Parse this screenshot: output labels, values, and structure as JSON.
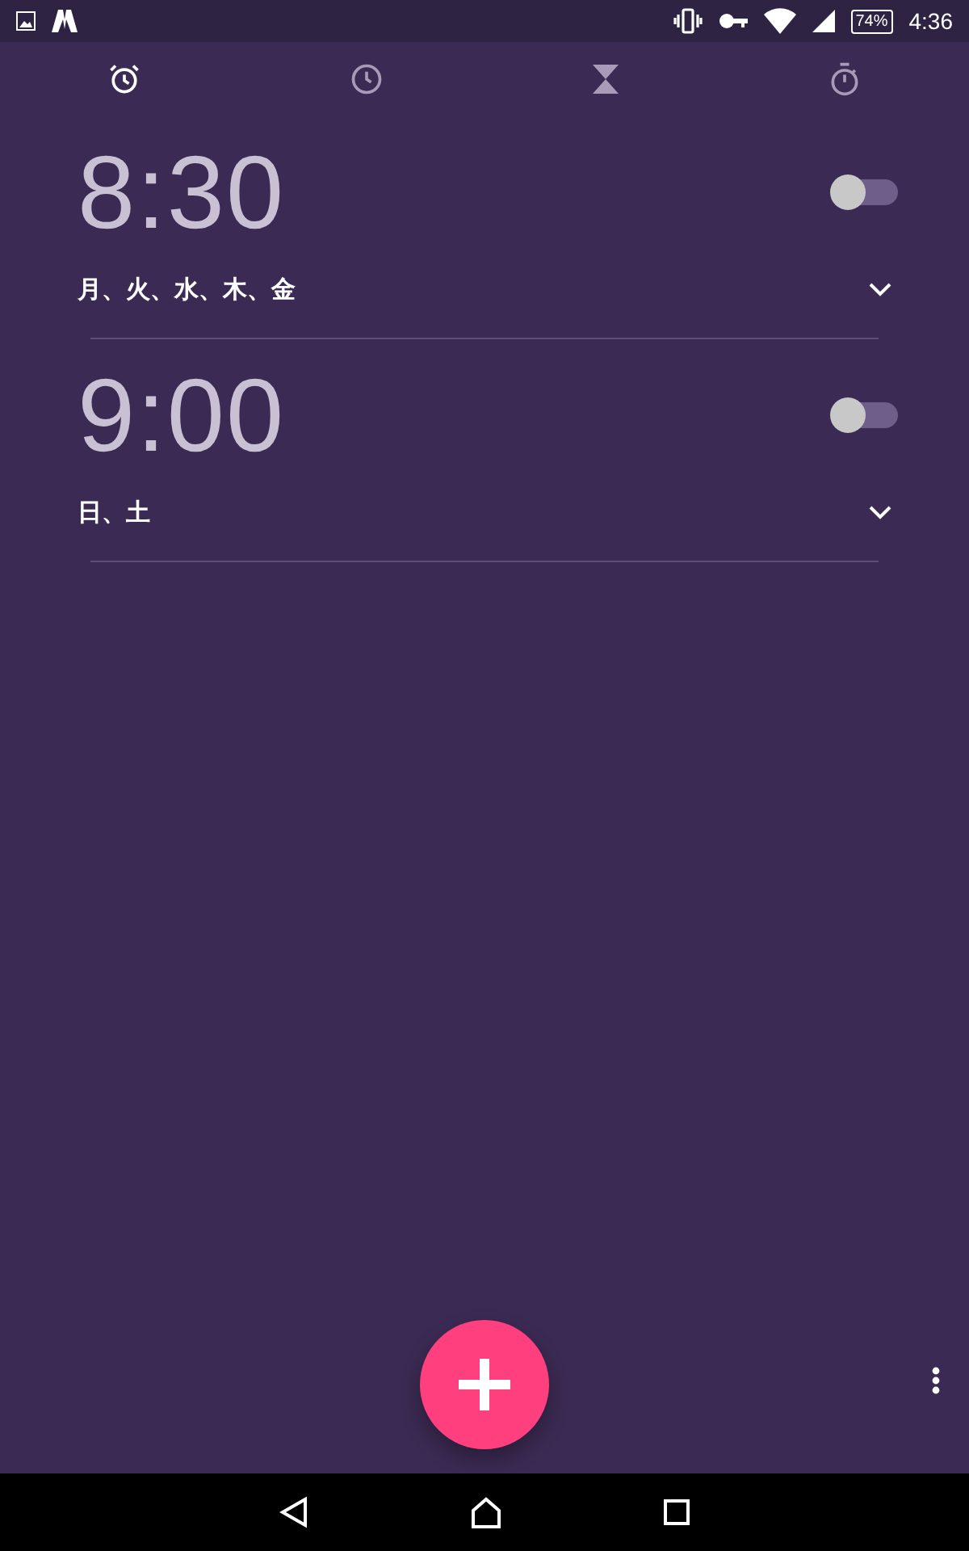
{
  "status_bar": {
    "battery": "74%",
    "time": "4:36"
  },
  "tabs": [
    {
      "kind": "alarm",
      "selected": true
    },
    {
      "kind": "clock",
      "selected": false
    },
    {
      "kind": "timer",
      "selected": false
    },
    {
      "kind": "stopwatch",
      "selected": false
    }
  ],
  "alarms": [
    {
      "time": "8:30",
      "days": "月、火、水、木、金",
      "on": false
    },
    {
      "time": "9:00",
      "days": "日、土",
      "on": false
    }
  ]
}
